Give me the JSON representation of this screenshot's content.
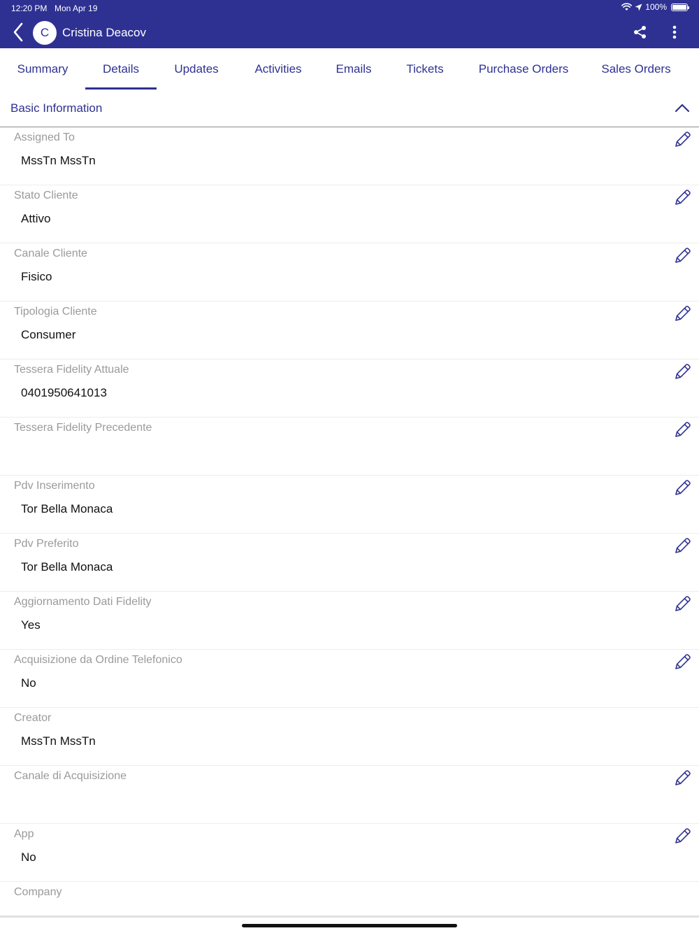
{
  "status_bar": {
    "time": "12:20 PM",
    "date": "Mon Apr 19",
    "battery": "100%",
    "icons": [
      "wifi-icon",
      "location-arrow-icon",
      "battery-icon"
    ]
  },
  "app_bar": {
    "avatar_initial": "C",
    "contact_name": "Cristina Deacov",
    "icons": [
      "back-chevron-icon",
      "share-icon",
      "more-vertical-icon"
    ],
    "background_color": "#2e3192"
  },
  "tabs": [
    {
      "label": "Summary",
      "active": false
    },
    {
      "label": "Details",
      "active": true
    },
    {
      "label": "Updates",
      "active": false
    },
    {
      "label": "Activities",
      "active": false
    },
    {
      "label": "Emails",
      "active": false
    },
    {
      "label": "Tickets",
      "active": false
    },
    {
      "label": "Purchase Orders",
      "active": false
    },
    {
      "label": "Sales Orders",
      "active": false
    }
  ],
  "section": {
    "title": "Basic Information",
    "icon": "chevron-up-icon"
  },
  "fields": [
    {
      "label": "Assigned To",
      "value": "MssTn MssTn",
      "editable": true
    },
    {
      "label": "Stato Cliente",
      "value": "Attivo",
      "editable": true
    },
    {
      "label": "Canale Cliente",
      "value": "Fisico",
      "editable": true
    },
    {
      "label": "Tipologia Cliente",
      "value": "Consumer",
      "editable": true
    },
    {
      "label": "Tessera Fidelity Attuale",
      "value": "0401950641013",
      "editable": true
    },
    {
      "label": "Tessera Fidelity Precedente",
      "value": "",
      "editable": true
    },
    {
      "label": "Pdv Inserimento",
      "value": "Tor Bella Monaca",
      "editable": true
    },
    {
      "label": "Pdv Preferito",
      "value": "Tor Bella Monaca",
      "editable": true
    },
    {
      "label": "Aggiornamento Dati Fidelity",
      "value": "Yes",
      "editable": true
    },
    {
      "label": "Acquisizione da Ordine Telefonico",
      "value": "No",
      "editable": true
    },
    {
      "label": "Creator",
      "value": "MssTn MssTn",
      "editable": false
    },
    {
      "label": "Canale di Acquisizione",
      "value": "",
      "editable": true
    },
    {
      "label": "App",
      "value": "No",
      "editable": true
    },
    {
      "label": "Company",
      "value": "",
      "editable": false
    }
  ],
  "colors": {
    "accent": "#2e3192",
    "label": "#9a9a9a",
    "value": "#111111"
  }
}
